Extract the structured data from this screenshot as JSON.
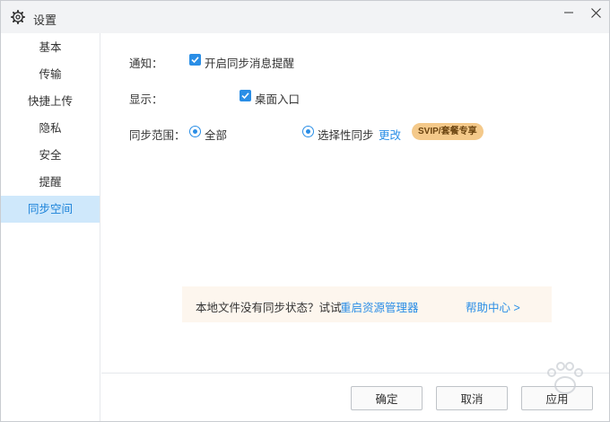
{
  "window": {
    "title": "设置",
    "icon": "gear-icon",
    "controls": [
      "minimize-icon",
      "close-icon"
    ]
  },
  "sidebar": {
    "items": [
      {
        "label": "基本",
        "active": false
      },
      {
        "label": "传输",
        "active": false
      },
      {
        "label": "快捷上传",
        "active": false
      },
      {
        "label": "隐私",
        "active": false
      },
      {
        "label": "安全",
        "active": false
      },
      {
        "label": "提醒",
        "active": false
      },
      {
        "label": "同步空间",
        "active": true
      }
    ]
  },
  "settings": {
    "notify": {
      "label": "通知：",
      "option": "开启同步消息提醒",
      "checked": true
    },
    "display": {
      "label": "显示：",
      "option": "桌面入口",
      "checked": true
    },
    "scope": {
      "label": "同步范围：",
      "options": [
        {
          "label": "全部",
          "selected": true
        },
        {
          "label": "选择性同步",
          "selected": true
        }
      ],
      "change_link": "更改",
      "badge": "SVIP/套餐专享"
    }
  },
  "notice": {
    "text": "本地文件没有同步状态？试试",
    "link": "重启资源管理器",
    "help": "帮助中心 >"
  },
  "footer": {
    "ok": "确定",
    "cancel": "取消",
    "apply": "应用"
  },
  "colors": {
    "accent": "#2a8ee6",
    "active_bg": "#cfe8fb",
    "badge_bg": "#f4c98a",
    "notice_bg": "#fdf6ee"
  }
}
